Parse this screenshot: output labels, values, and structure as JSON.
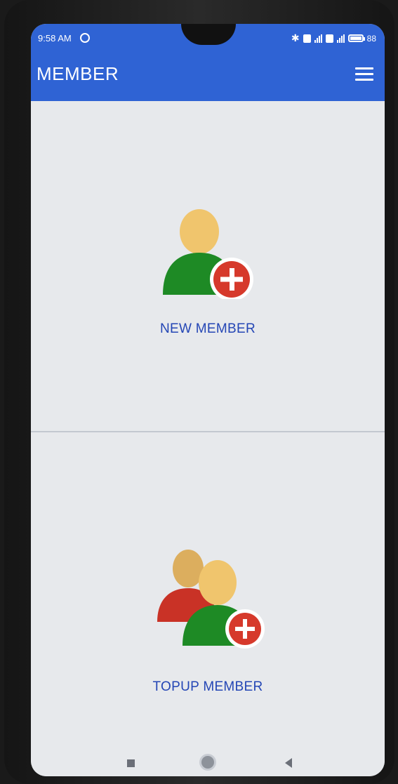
{
  "status_bar": {
    "time": "9:58 AM",
    "battery": "88"
  },
  "app_bar": {
    "title": "MEMBER"
  },
  "tiles": {
    "new_member": {
      "label": "NEW MEMBER"
    },
    "topup_member": {
      "label": "TOPUP MEMBER"
    }
  },
  "colors": {
    "app_bar": "#2f63d4",
    "label": "#2446b5",
    "person_head": "#f0c56d",
    "person_body_green": "#1e8a25",
    "person_body_red": "#c93226",
    "plus_badge": "#d6392b"
  },
  "icons": {
    "menu": "hamburger-menu-icon",
    "new_member": "add-user-icon",
    "topup_member": "add-group-icon"
  }
}
